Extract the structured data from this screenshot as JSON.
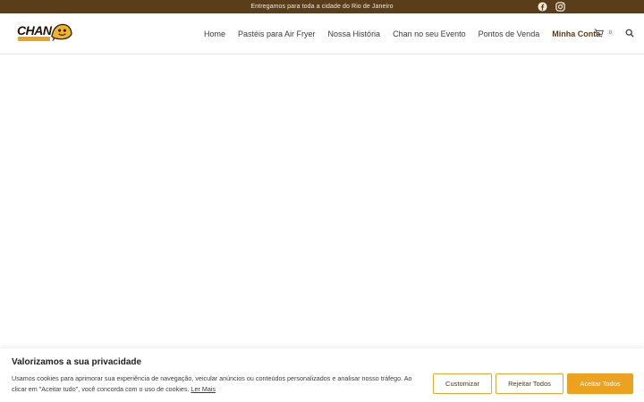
{
  "topbar": {
    "announcement": "Entregamos para toda a cidade do Rio de Janeiro",
    "social": [
      "facebook-icon",
      "instagram-icon"
    ]
  },
  "header": {
    "logo_text": "CHAN",
    "nav": [
      {
        "label": "Home"
      },
      {
        "label": "Pastéis para Air Fryer"
      },
      {
        "label": "Nossa História"
      },
      {
        "label": "Chan no seu Evento"
      },
      {
        "label": "Pontos de Venda"
      },
      {
        "label": "Minha Conta"
      }
    ],
    "cart_count": "0"
  },
  "cookie": {
    "title": "Valorizamos a sua privacidade",
    "text": "Usamos cookies para aprimorar sua experiência de navegação, veicular anúncios ou conteúdos personalizados e analisar nosso tráfego. Ao clicar em \"Aceitar tudo\", você concorda com o uso de cookies.",
    "read_more": "Ler Mais",
    "customize": "Customizar",
    "reject": "Rejeitar Todos",
    "accept": "Aceitar Todos"
  },
  "colors": {
    "topbar": "#5a3d1a",
    "accent": "#eca11f",
    "active_nav": "#5a3d1a"
  }
}
